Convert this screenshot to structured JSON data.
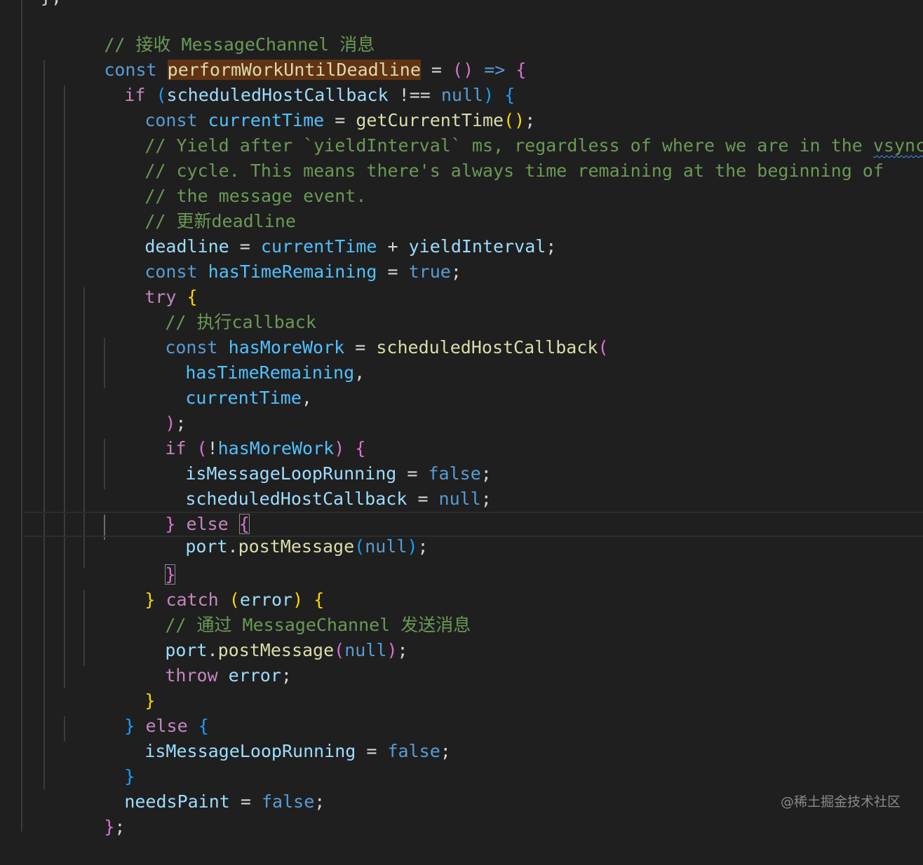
{
  "editor": {
    "top_cutoff_text": "};",
    "watermark": "@稀土掘金技术社区",
    "lines": {
      "l1": {
        "comment": "// 接收 MessageChannel 消息"
      },
      "l2": {
        "const": "const",
        "name": "performWorkUntilDeadline",
        "eq": " = ",
        "paren": "()",
        "arrow": " => ",
        "brace": "{"
      },
      "l3": {
        "if": "if",
        "paren_open": "(",
        "var": "scheduledHostCallback",
        "op": " !== ",
        "null": "null",
        "paren_close": ")",
        "brace": "{"
      },
      "l4": {
        "const": "const",
        "var": "currentTime",
        "eq": " = ",
        "fn": "getCurrentTime",
        "paren": "()",
        "semi": ";"
      },
      "l5": {
        "comment_a": "// Yield after `yieldInterval` ms, regardless of where we are in the ",
        "comment_b": "vsync"
      },
      "l6": {
        "comment": "// cycle. This means there's always time remaining at the beginning of"
      },
      "l7": {
        "comment": "// the message event."
      },
      "l8": {
        "comment": "// 更新deadline"
      },
      "l9": {
        "var": "deadline",
        "eq": " = ",
        "var2": "currentTime",
        "plus": " + ",
        "var3": "yieldInterval",
        "semi": ";"
      },
      "l10": {
        "const": "const",
        "var": "hasTimeRemaining",
        "eq": " = ",
        "bool": "true",
        "semi": ";"
      },
      "l11": {
        "try": "try",
        "brace": "{"
      },
      "l12": {
        "comment": "// 执行callback"
      },
      "l13": {
        "const": "const",
        "var": "hasMoreWork",
        "eq": " = ",
        "fn": "scheduledHostCallback",
        "paren": "("
      },
      "l14": {
        "var": "hasTimeRemaining",
        "comma": ","
      },
      "l15": {
        "var": "currentTime",
        "comma": ","
      },
      "l16": {
        "paren": ")",
        "semi": ";"
      },
      "l17": {
        "if": "if",
        "paren_open": "(",
        "bang": "!",
        "var": "hasMoreWork",
        "paren_close": ")",
        "brace": "{"
      },
      "l18": {
        "var": "isMessageLoopRunning",
        "eq": " = ",
        "bool": "false",
        "semi": ";"
      },
      "l19": {
        "var": "scheduledHostCallback",
        "eq": " = ",
        "null": "null",
        "semi": ";"
      },
      "l20": {
        "brace_close": "}",
        "else": "else",
        "brace_open": "{"
      },
      "l21": {
        "var": "port",
        "dot": ".",
        "fn": "postMessage",
        "paren_open": "(",
        "null": "null",
        "paren_close": ")",
        "semi": ";"
      },
      "l22": {
        "brace": "}"
      },
      "l23": {
        "brace_close": "}",
        "catch": "catch",
        "paren_open": "(",
        "var": "error",
        "paren_close": ")",
        "brace_open": "{"
      },
      "l24": {
        "comment": "// 通过 MessageChannel 发送消息"
      },
      "l25": {
        "var": "port",
        "dot": ".",
        "fn": "postMessage",
        "paren_open": "(",
        "null": "null",
        "paren_close": ")",
        "semi": ";"
      },
      "l26": {
        "throw": "throw",
        "var": "error",
        "semi": ";"
      },
      "l27": {
        "brace": "}"
      },
      "l28": {
        "brace_close": "}",
        "else": "else",
        "brace_open": "{"
      },
      "l29": {
        "var": "isMessageLoopRunning",
        "eq": " = ",
        "bool": "false",
        "semi": ";"
      },
      "l30": {
        "brace": "}"
      },
      "l31": {
        "var": "needsPaint",
        "eq": " = ",
        "bool": "false",
        "semi": ";"
      },
      "l32": {
        "brace": "}",
        "semi": ";"
      }
    }
  },
  "colors": {
    "background": "#1f1f1f",
    "keyword_storage": "#569cd6",
    "keyword_control": "#c586c0",
    "constant_variable": "#4fc1ff",
    "variable": "#9cdcfe",
    "function": "#dcdcaa",
    "comment": "#6a9955",
    "bracket_level1": "#ffd700",
    "bracket_level2": "#da70d6",
    "bracket_level3": "#179fff",
    "selection_highlight": "#613315"
  }
}
